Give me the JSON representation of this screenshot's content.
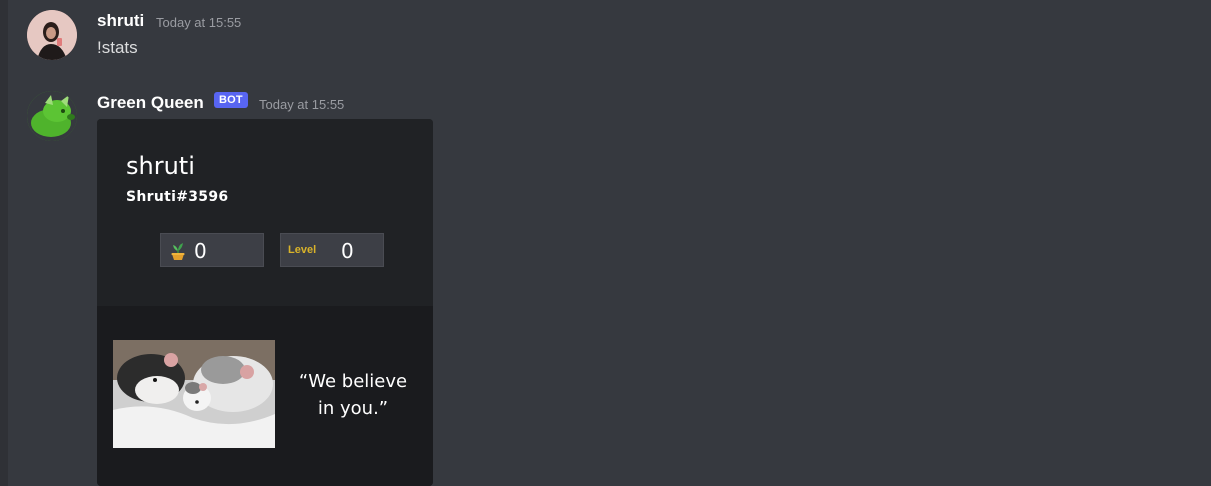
{
  "messages": [
    {
      "author": "shruti",
      "timestamp": "Today at 15:55",
      "content": "!stats"
    },
    {
      "author": "Green Queen",
      "badge": "BOT",
      "timestamp": "Today at 15:55",
      "embed": {
        "name": "shruti",
        "tag": "Shruti#3596",
        "coins": "0",
        "coins_icon": "sprout-icon",
        "level_label": "Level",
        "level_value": "0",
        "quote": "“We believe in you.”"
      }
    }
  ],
  "colors": {
    "background": "#36393f",
    "bot_badge": "#5865f2",
    "level_label": "#d9b32a"
  }
}
